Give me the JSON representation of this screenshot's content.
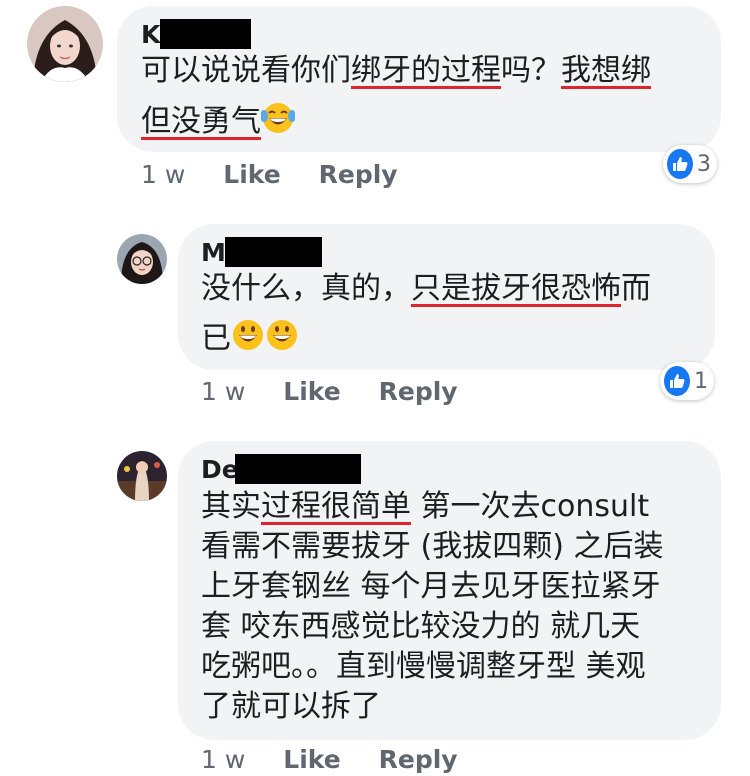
{
  "comments": [
    {
      "author": "K",
      "lines": [
        [
          {
            "t": "可以说说看你们"
          },
          {
            "t": "绑牙的过程",
            "u": true
          },
          {
            "t": "吗？"
          },
          {
            "t": "我想绑",
            "u": true
          }
        ],
        [
          {
            "t": "但没勇气",
            "u": true
          },
          {
            "e": "laugh-cry"
          }
        ]
      ],
      "time": "1 w",
      "like_label": "Like",
      "reply_label": "Reply",
      "reaction_count": "3"
    },
    {
      "author": "M",
      "lines": [
        [
          {
            "t": "没什么，真的，"
          },
          {
            "t": "只是拔牙很恐怖",
            "u": true
          },
          {
            "t": "而"
          }
        ],
        [
          {
            "t": "已"
          },
          {
            "e": "grin"
          },
          {
            "e": "grin"
          }
        ]
      ],
      "time": "1 w",
      "like_label": "Like",
      "reply_label": "Reply",
      "reaction_count": "1"
    },
    {
      "author": "De",
      "lines": [
        [
          {
            "t": "其实"
          },
          {
            "t": "过程很简单",
            "u": true
          },
          {
            "t": " 第一次去consult"
          }
        ],
        [
          {
            "t": "看需不需要拔牙 (我拔四颗) 之后装"
          }
        ],
        [
          {
            "t": "上牙套钢丝 每个月去见牙医拉紧牙"
          }
        ],
        [
          {
            "t": "套 咬东西感觉比较没力的 就几天"
          }
        ],
        [
          {
            "t": "吃粥吧。。直到慢慢调整牙型 美观"
          }
        ],
        [
          {
            "t": "了就可以拆了"
          }
        ]
      ],
      "time": "1 w",
      "like_label": "Like",
      "reply_label": "Reply"
    }
  ]
}
